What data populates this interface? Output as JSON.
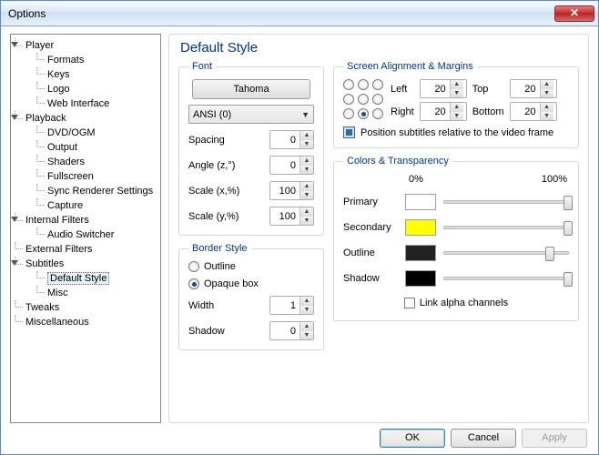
{
  "window": {
    "title": "Options"
  },
  "tree": {
    "player": "Player",
    "formats": "Formats",
    "keys": "Keys",
    "logo": "Logo",
    "web": "Web Interface",
    "playback": "Playback",
    "dvd": "DVD/OGM",
    "output": "Output",
    "shaders": "Shaders",
    "fullscreen": "Fullscreen",
    "sync": "Sync Renderer Settings",
    "capture": "Capture",
    "intfilters": "Internal Filters",
    "audiosw": "Audio Switcher",
    "extfilters": "External Filters",
    "subtitles": "Subtitles",
    "defstyle": "Default Style",
    "misc": "Misc",
    "tweaks": "Tweaks",
    "miscroot": "Miscellaneous"
  },
  "panel": {
    "title": "Default Style"
  },
  "font": {
    "legend": "Font",
    "face_button": "Tahoma",
    "charset": "ANSI (0)",
    "spacing_label": "Spacing",
    "spacing": "0",
    "angle_label": "Angle (z,°)",
    "angle": "0",
    "scalex_label": "Scale (x,%)",
    "scalex": "100",
    "scaley_label": "Scale (y,%)",
    "scaley": "100"
  },
  "border": {
    "legend": "Border Style",
    "outline_radio": "Outline",
    "opaque_radio": "Opaque box",
    "width_label": "Width",
    "width": "1",
    "shadow_label": "Shadow",
    "shadow": "0"
  },
  "align": {
    "legend": "Screen Alignment & Margins",
    "left": "Left",
    "left_v": "20",
    "top": "Top",
    "top_v": "20",
    "right": "Right",
    "right_v": "20",
    "bottom": "Bottom",
    "bottom_v": "20",
    "relative": "Position subtitles relative to the video frame"
  },
  "colors": {
    "legend": "Colors & Transparency",
    "pct0": "0%",
    "pct100": "100%",
    "primary": "Primary",
    "primary_c": "#ffffff",
    "primary_p": 100,
    "secondary": "Secondary",
    "secondary_c": "#ffff00",
    "secondary_p": 100,
    "outline": "Outline",
    "outline_c": "#222222",
    "outline_p": 85,
    "shadow": "Shadow",
    "shadow_c": "#000000",
    "shadow_p": 100,
    "link": "Link alpha channels"
  },
  "buttons": {
    "ok": "OK",
    "cancel": "Cancel",
    "apply": "Apply"
  }
}
